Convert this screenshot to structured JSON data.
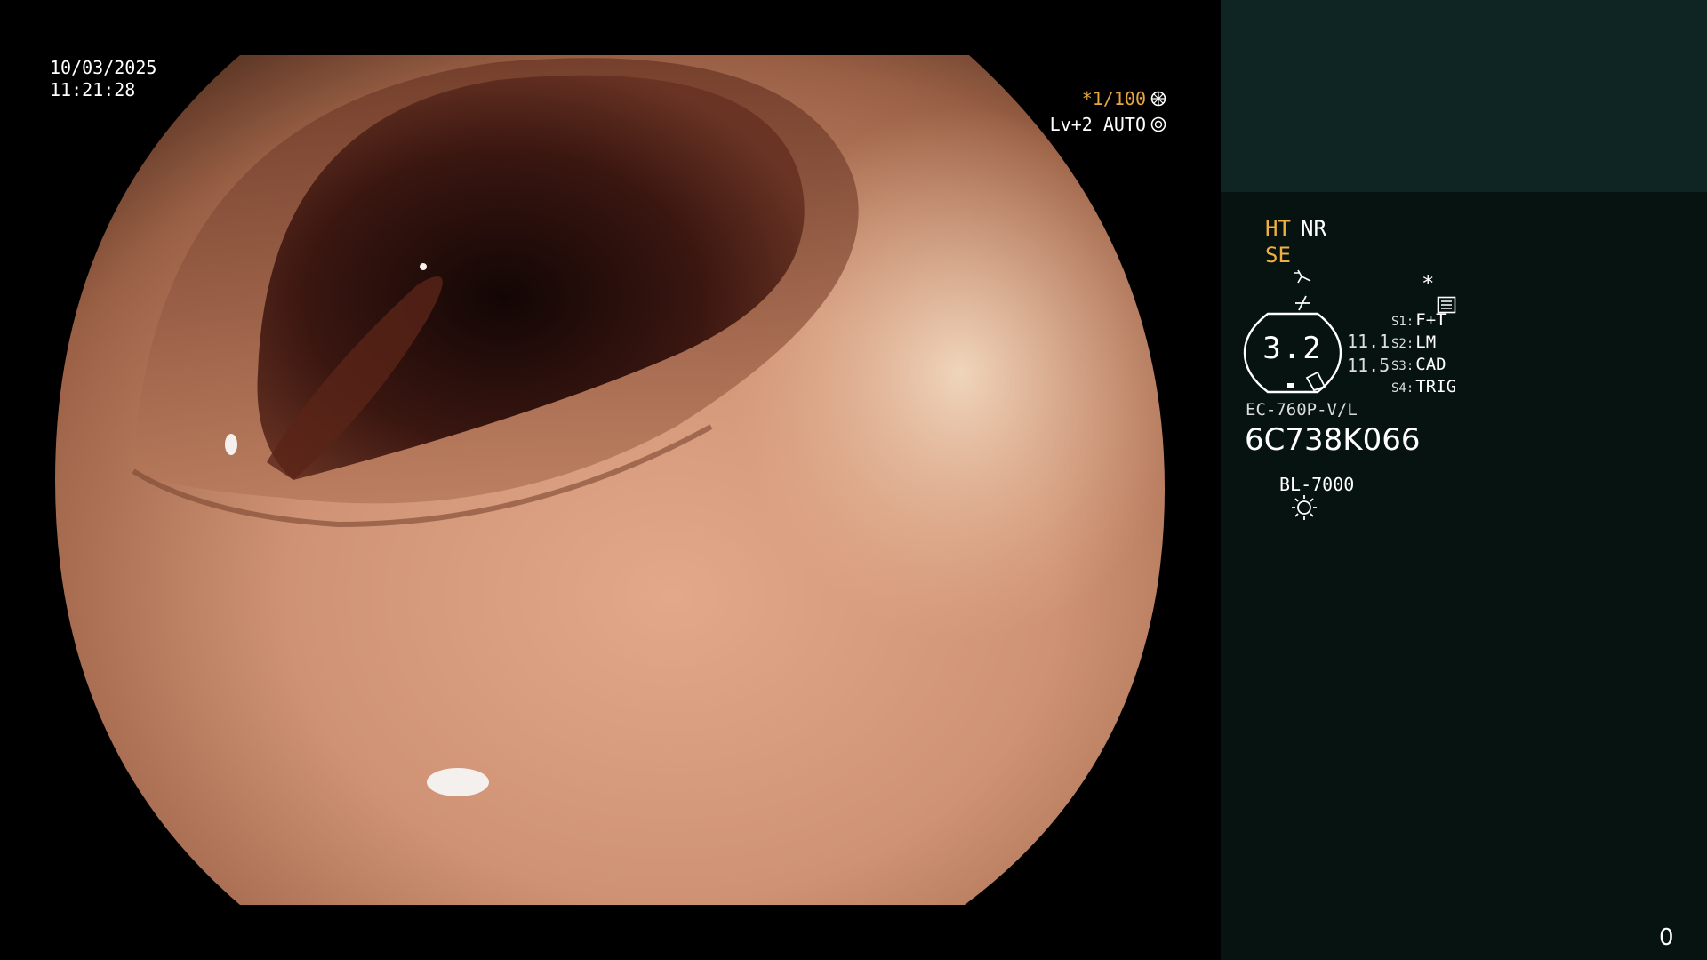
{
  "overlay": {
    "date": "10/03/2025",
    "time": "11:21:28",
    "shutter": "*1/100",
    "level": "Lv+2 AUTO",
    "icons": [
      "aperture-icon",
      "iris-icon"
    ]
  },
  "panel": {
    "ht_label": "HT",
    "nr_label": "NR",
    "se_label": "SE",
    "asterisk": "*",
    "gauge_value": "3.2",
    "values": [
      "11.1",
      "11.5"
    ],
    "switches": [
      {
        "key": "S1:",
        "value": "F+T"
      },
      {
        "key": "S2:",
        "value": "LM"
      },
      {
        "key": "S3:",
        "value": "CAD"
      },
      {
        "key": "S4:",
        "value": "TRIG"
      }
    ],
    "scope_model": "EC-760P-V/L",
    "serial": "6C738K066",
    "light_source": "BL-7000",
    "counter": "0"
  },
  "colors": {
    "accent_orange": "#f0b040",
    "panel_bg": "#061311",
    "panel_header_bg": "#0f2523",
    "tissue": "#c98d6c"
  }
}
